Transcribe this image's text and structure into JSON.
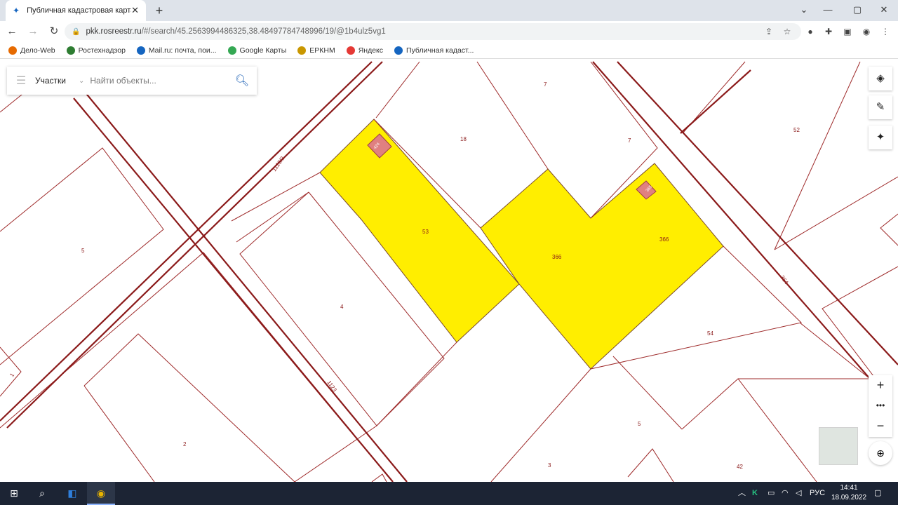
{
  "browser": {
    "tab_title": "Публичная кадастровая карта",
    "url": "pkk.rosreestr.ru",
    "url_path": "/#/search/45.2563994486325,38.48497784748996/19/@1b4ulz5vg1"
  },
  "bookmarks": [
    {
      "label": "Дело-Web",
      "color": "#e66a00"
    },
    {
      "label": "Ростехнадзор",
      "color": "#2e7d32"
    },
    {
      "label": "Mail.ru: почта, пои...",
      "color": "#1565c0"
    },
    {
      "label": "Google Карты",
      "color": "#34a853"
    },
    {
      "label": "ЕРКНМ",
      "color": "#c99700"
    },
    {
      "label": "Яндекс",
      "color": "#e53935"
    },
    {
      "label": "Публичная кадаст...",
      "color": "#1565c0"
    }
  ],
  "search": {
    "category": "Участки",
    "placeholder": "Найти объекты..."
  },
  "map": {
    "parcel_labels": [
      "7",
      "18",
      "7",
      "52",
      "1123/2",
      "5",
      "53",
      "366",
      "366",
      "4",
      "364",
      "54",
      "2",
      "5",
      "3",
      "42",
      "1",
      "1123"
    ],
    "building_labels": [
      "424",
      "365"
    ],
    "colors": {
      "selected": "#ffee00",
      "boundary": "#9e2a2a",
      "building": "#e08080"
    }
  },
  "taskbar": {
    "lang": "РУС",
    "time": "14:41",
    "date": "18.09.2022"
  }
}
